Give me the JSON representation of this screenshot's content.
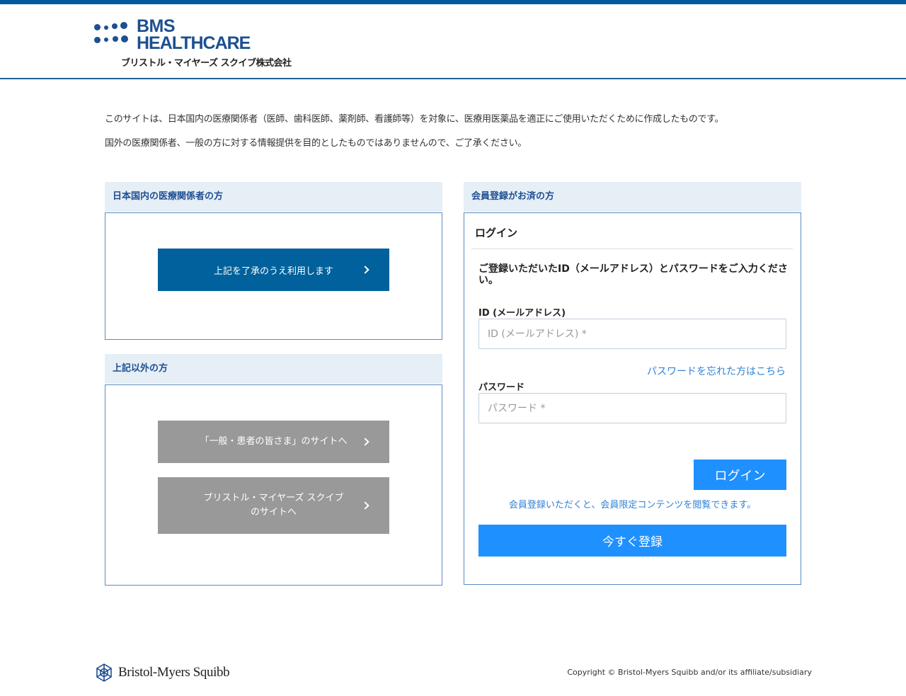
{
  "header": {
    "logo_line1": "BMS",
    "logo_line2": "HEALTHCARE",
    "logo_company_jp": "ブリストル・マイヤーズ スクイブ株式会社"
  },
  "intro": {
    "line1": "このサイトは、日本国内の医療関係者（医師、歯科医師、薬剤師、看護師等）を対象に、医療用医薬品を適正にご使用いただくために作成したものです。",
    "line2": "国外の医療関係者、一般の方に対する情報提供を目的としたものではありませんので、ご了承ください。"
  },
  "domestic_panel": {
    "heading": "日本国内の医療関係者の方",
    "accept_button": "上記を了承のうえ利用します"
  },
  "other_panel": {
    "heading": "上記以外の方",
    "patient_button": "「一般・患者の皆さま」のサイトへ",
    "bms_button_line1": "ブリストル・マイヤーズ スクイブ",
    "bms_button_line2": "のサイトへ"
  },
  "member_panel": {
    "heading": "会員登録がお済の方",
    "login_title": "ログイン",
    "instruction": "ご登録いただいたID（メールアドレス）とパスワードをご入力ください。",
    "id_label": "ID (メールアドレス)",
    "id_placeholder": "ID (メールアドレス) *",
    "forgot_link": "パスワードを忘れた方はこちら",
    "password_label": "パスワード",
    "password_placeholder": "パスワード *",
    "login_button": "ログイン",
    "member_note": "会員登録いただくと、会員限定コンテンツを閲覧できます。",
    "register_button": "今すぐ登録"
  },
  "footer": {
    "company": "Bristol-Myers Squibb",
    "copyright": "Copyright © Bristol-Myers Squibb and/or its affiliate/subsidiary"
  },
  "colors": {
    "brand_navy": "#1d4f91",
    "primary_blue": "#00619c",
    "login_blue": "#1e90ff",
    "link_blue": "#2f83d6",
    "panel_head_bg": "#e6eef6",
    "disabled_gray": "#999999"
  }
}
